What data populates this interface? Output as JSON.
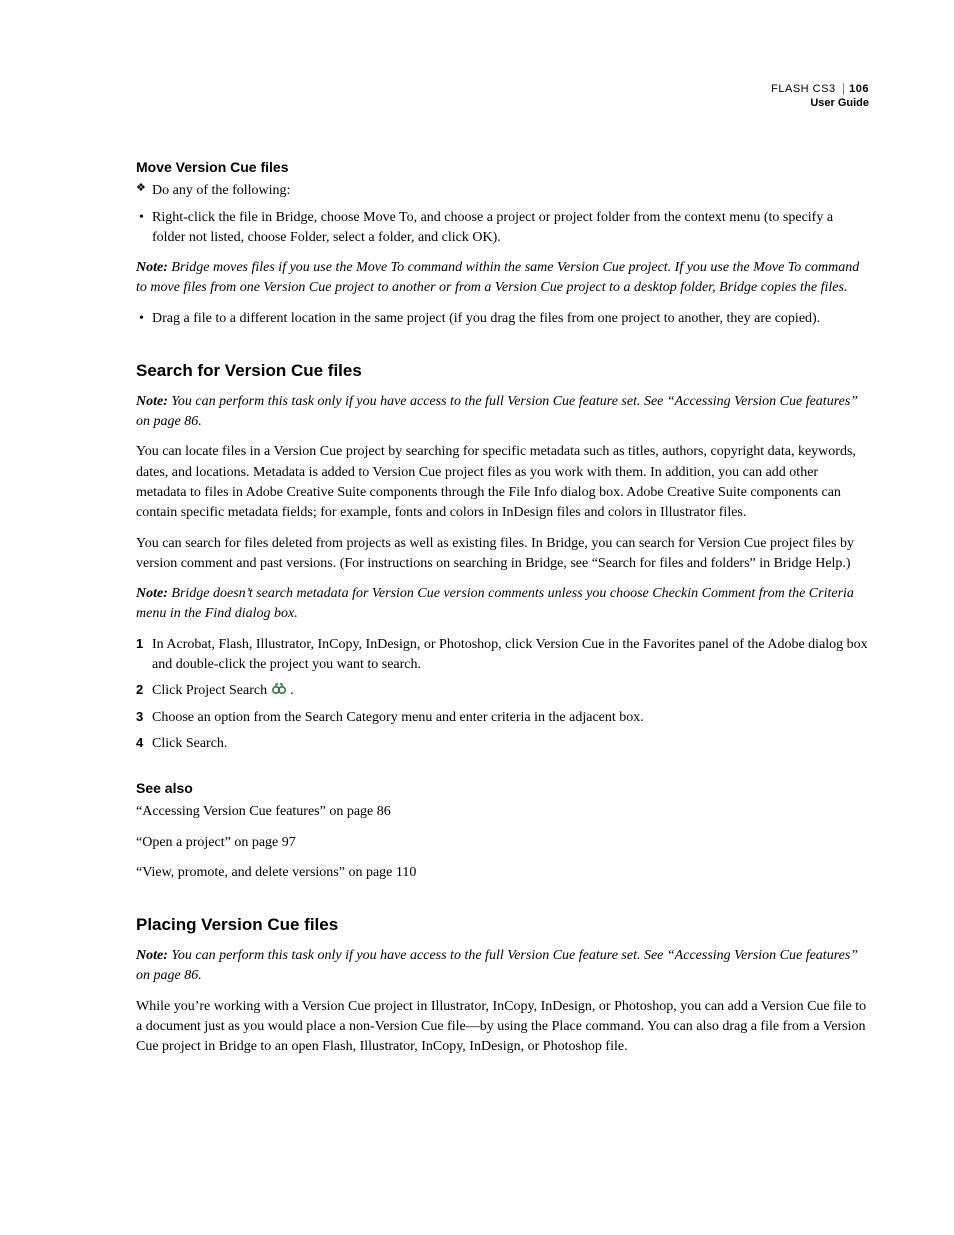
{
  "header": {
    "product": "FLASH CS3",
    "page_number": "106",
    "subtitle": "User Guide"
  },
  "section_move": {
    "title": "Move Version Cue files",
    "lead": "Do any of the following:",
    "bullet1": "Right-click the file in Bridge, choose Move To, and choose a project or project folder from the context menu (to specify a folder not listed, choose Folder, select a folder, and click OK).",
    "note_label": "Note:",
    "note": " Bridge moves files if you use the Move To command within the same Version Cue project. If you use the Move To command to move files from one Version Cue project to another or from a Version Cue project to a desktop folder, Bridge copies the files.",
    "bullet2": "Drag a file to a different location in the same project (if you drag the files from one project to another, they are copied)."
  },
  "section_search": {
    "title": "Search for Version Cue files",
    "note1_label": "Note:",
    "note1": " You can perform this task only if you have access to the full Version Cue feature set. See “Accessing Version Cue features” on page 86.",
    "para1": "You can locate files in a Version Cue project by searching for specific metadata such as titles, authors, copyright data, keywords, dates, and locations. Metadata is added to Version Cue project files as you work with them. In addition, you can add other metadata to files in Adobe Creative Suite components through the File Info dialog box. Adobe Creative Suite components can contain specific metadata fields; for example, fonts and colors in InDesign files and colors in Illustrator files.",
    "para2": "You can search for files deleted from projects as well as existing files. In Bridge, you can search for Version Cue project files by version comment and past versions. (For instructions on searching in Bridge, see “Search for files and folders” in Bridge Help.)",
    "note2_label": "Note:",
    "note2": " Bridge doesn’t search metadata for Version Cue version comments unless you choose Checkin Comment from the Criteria menu in the Find dialog box.",
    "step1": "In Acrobat, Flash, Illustrator, InCopy, InDesign, or Photoshop, click Version Cue in the Favorites panel of the Adobe dialog box and double-click the project you want to search.",
    "step2_before": "Click Project Search ",
    "step2_after": " .",
    "step3": "Choose an option from the Search Category menu and enter criteria in the adjacent box.",
    "step4": "Click Search."
  },
  "section_seealso": {
    "title": "See also",
    "link1": "“Accessing Version Cue features” on page 86",
    "link2": "“Open a project” on page 97",
    "link3": "“View, promote, and delete versions” on page 110"
  },
  "section_placing": {
    "title": "Placing Version Cue files",
    "note_label": "Note:",
    "note": " You can perform this task only if you have access to the full Version Cue feature set. See “Accessing Version Cue features” on page 86.",
    "para": "While you’re working with a Version Cue project in Illustrator, InCopy, InDesign, or Photoshop, you can add a Version Cue file to a document just as you would place a non-Version Cue file—by using the Place command. You can also drag a file from a Version Cue project in Bridge to an open Flash, Illustrator, InCopy, InDesign, or Photoshop file."
  }
}
